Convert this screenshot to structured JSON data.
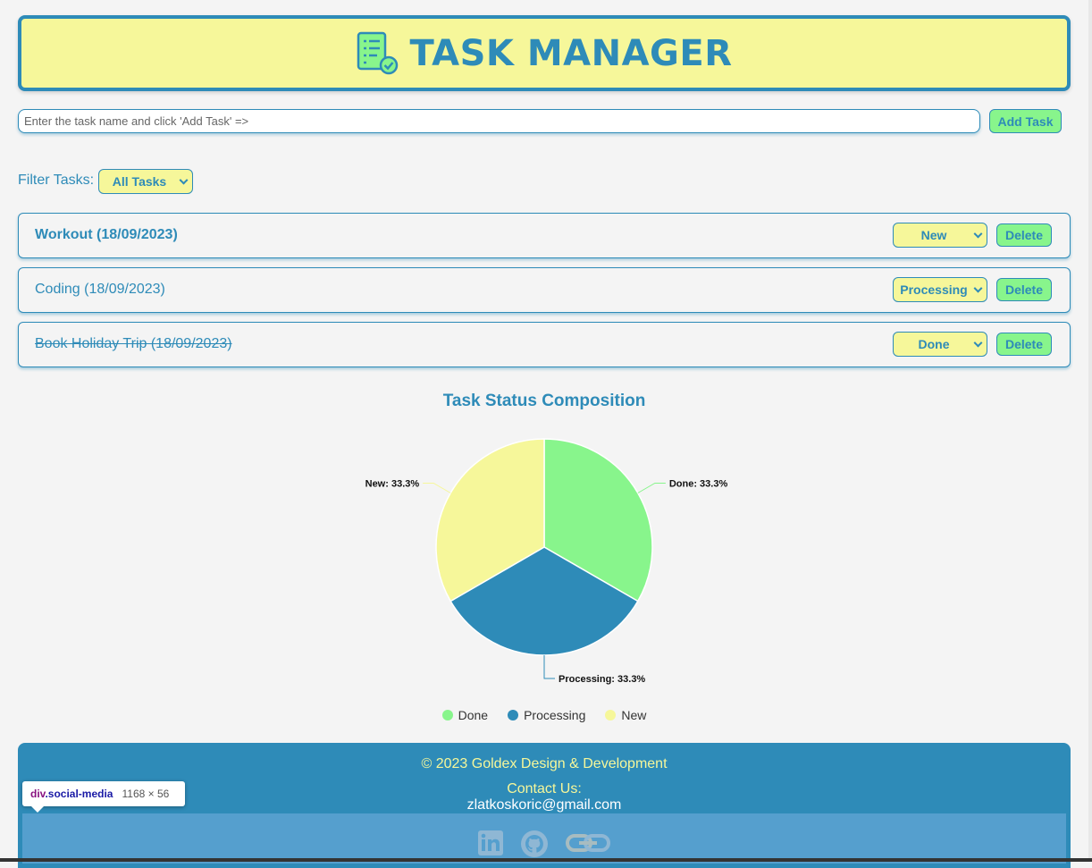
{
  "header": {
    "title": "TASK MANAGER",
    "icon": "checklist-icon"
  },
  "input": {
    "placeholder": "Enter the task name and click 'Add Task' =>",
    "value": ""
  },
  "add_button": "Add Task",
  "filter": {
    "label": "Filter Tasks:",
    "selected": "All Tasks"
  },
  "tasks": [
    {
      "name": "Workout (18/09/2023)",
      "status": "New",
      "delete_label": "Delete",
      "style": "bold"
    },
    {
      "name": "Coding (18/09/2023)",
      "status": "Processing",
      "delete_label": "Delete",
      "style": "normal"
    },
    {
      "name": "Book Holiday Trip (18/09/2023)",
      "status": "Done",
      "delete_label": "Delete",
      "style": "strikethrough"
    }
  ],
  "chart_data": {
    "type": "pie",
    "title": "Task Status Composition",
    "categories": [
      "Done",
      "Processing",
      "New"
    ],
    "values": [
      33.3,
      33.3,
      33.3
    ],
    "labels": [
      "Done: 33.3%",
      "Processing: 33.3%",
      "New: 33.3%"
    ],
    "colors": [
      "#88f58c",
      "#2e8bb8",
      "#f6f79a"
    ],
    "legend_position": "bottom"
  },
  "footer": {
    "copyright": "© 2023 Goldex Design & Development",
    "contact_label": "Contact Us:",
    "email": "zlatkoskoric@gmail.com",
    "social": [
      "linkedin-icon",
      "github-icon",
      "link-icon"
    ]
  },
  "devtools_tooltip": {
    "tag": "div",
    "class": ".social-media",
    "size": "1168 × 56"
  },
  "colors": {
    "primary": "#2e8bb8",
    "accent": "#f6f79a",
    "green": "#88f58c"
  }
}
